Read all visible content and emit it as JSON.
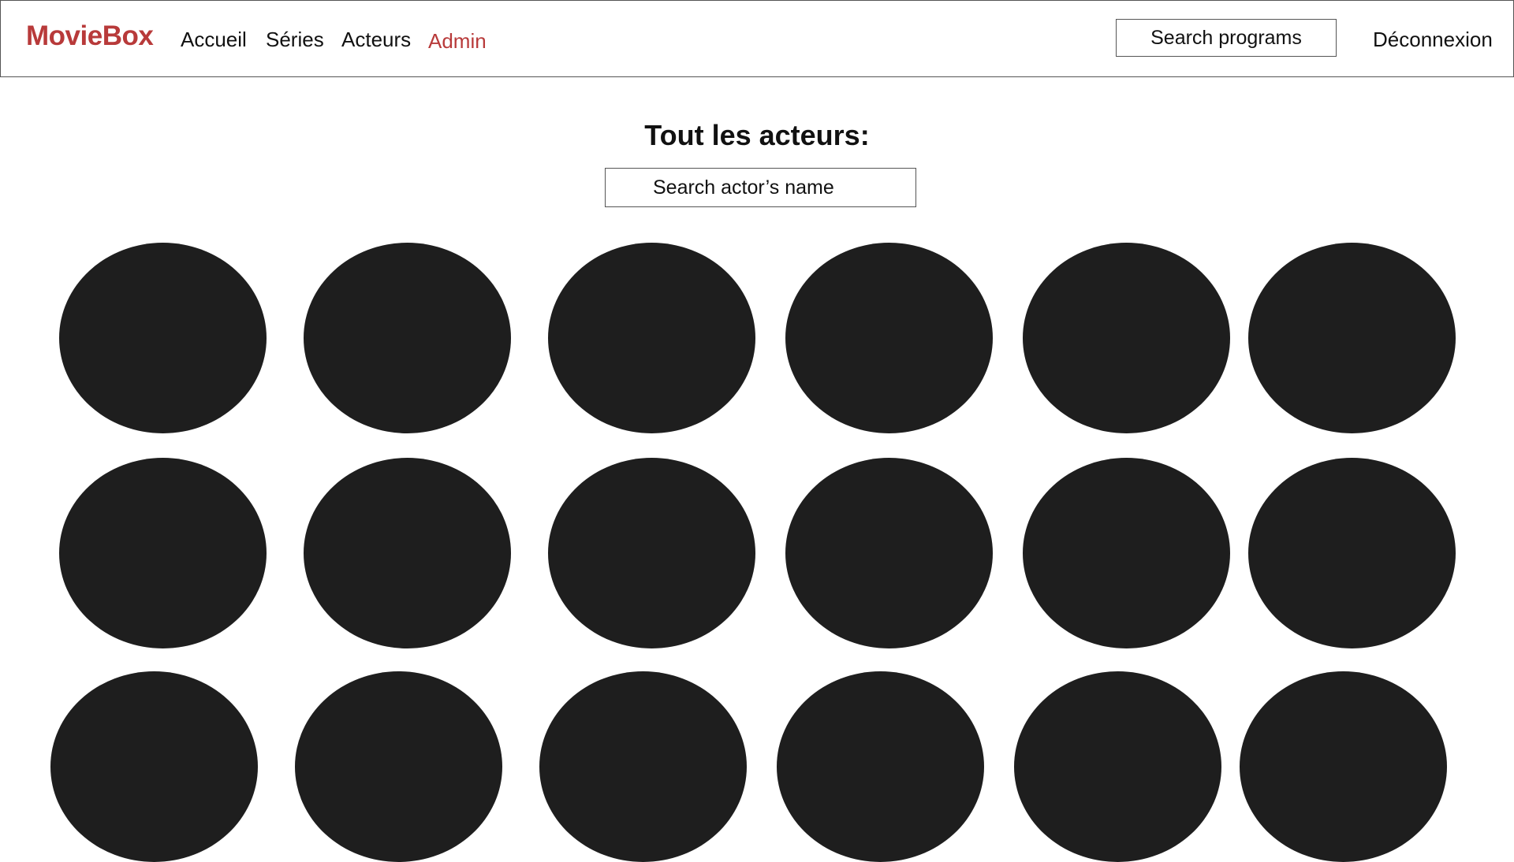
{
  "header": {
    "brand": "MovieBox",
    "nav": [
      {
        "label": "Accueil",
        "active": false
      },
      {
        "label": "Séries",
        "active": false
      },
      {
        "label": "Acteurs",
        "active": false
      },
      {
        "label": "Admin",
        "active": true
      }
    ],
    "search_placeholder": "Search programs",
    "logout_label": "Déconnexion"
  },
  "main": {
    "title": "Tout les acteurs:",
    "search_placeholder": "Search actor’s name",
    "actor_rows": 3,
    "actors_per_row": 6
  },
  "colors": {
    "brand": "#b83a3a",
    "avatar_placeholder": "#1e1e1e",
    "border": "#555555"
  }
}
